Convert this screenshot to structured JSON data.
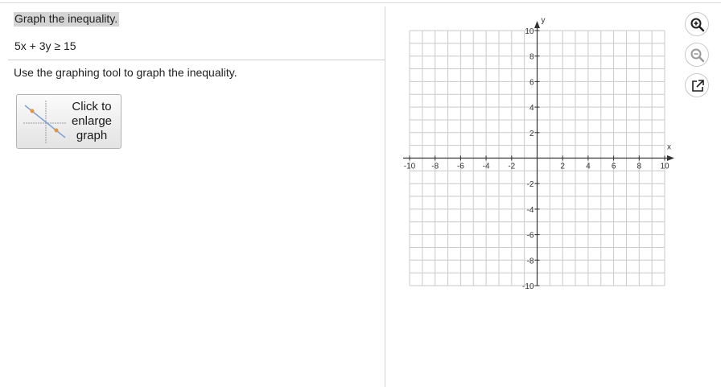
{
  "question": {
    "prompt": "Graph the inequality.",
    "equation": "5x + 3y ≥ 15",
    "instruction": "Use the graphing tool to graph the inequality."
  },
  "enlarge_button": {
    "label_lines": [
      "Click to",
      "enlarge",
      "graph"
    ],
    "icon": "graph-thumbnail-icon"
  },
  "graph": {
    "x_axis_label": "x",
    "y_axis_label": "y",
    "x_range": [
      -10,
      10
    ],
    "y_range": [
      -10,
      10
    ],
    "grid_step": 1,
    "tick_label_step": 2,
    "x_tick_labels": [
      "-10",
      "-8",
      "-6",
      "-4",
      "-2",
      "2",
      "4",
      "6",
      "8",
      "10"
    ],
    "y_tick_labels": [
      "10",
      "8",
      "6",
      "4",
      "2",
      "-2",
      "-4",
      "-6",
      "-8",
      "-10"
    ],
    "grid_color": "#c9c9c9",
    "axis_color": "#333333"
  },
  "tools": [
    {
      "name": "zoom-in-icon",
      "accent": "#1f1f1f"
    },
    {
      "name": "zoom-out-icon",
      "accent": "#9a9a9a"
    },
    {
      "name": "popout-icon",
      "accent": "#1f1f1f"
    }
  ]
}
